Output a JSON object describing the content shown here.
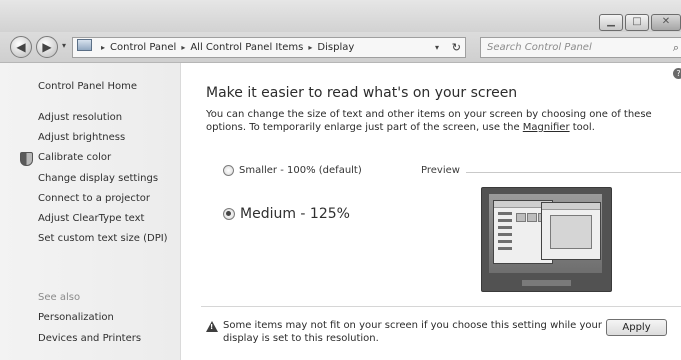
{
  "window": {
    "minimize_glyph": "▁",
    "maximize_glyph": "□",
    "close_glyph": "✕"
  },
  "nav": {
    "back_glyph": "◀",
    "forward_glyph": "▶",
    "recent_glyph": "▾",
    "breadcrumb": [
      "Control Panel",
      "All Control Panel Items",
      "Display"
    ],
    "breadcrumb_separator": "▸",
    "dropdown_glyph": "▾",
    "refresh_glyph": "↻",
    "search_placeholder": "Search Control Panel",
    "search_icon": "⌕"
  },
  "sidebar": {
    "home": "Control Panel Home",
    "links": [
      "Adjust resolution",
      "Adjust brightness",
      "Calibrate color",
      "Change display settings",
      "Connect to a projector",
      "Adjust ClearType text",
      "Set custom text size (DPI)"
    ],
    "see_also_label": "See also",
    "see_also": [
      "Personalization",
      "Devices and Printers"
    ]
  },
  "main": {
    "help_glyph": "?",
    "title": "Make it easier to read what's on your screen",
    "description_before": "You can change the size of text and other items on your screen by choosing one of these options. To temporarily enlarge just part of the screen, use the ",
    "magnifier_link": "Magnifier",
    "description_after": " tool.",
    "options": {
      "smaller": "Smaller - 100% (default)",
      "medium": "Medium - 125%"
    },
    "selected_option": "medium",
    "preview_label": "Preview",
    "warning_glyph": "!",
    "warning_text": "Some items may not fit on your screen if you choose this setting while your display is set to this resolution.",
    "apply_label": "Apply"
  },
  "colors": {
    "sidebar_bg": "#f3f3f3",
    "titlebar_bg": "#d2d2d2"
  }
}
